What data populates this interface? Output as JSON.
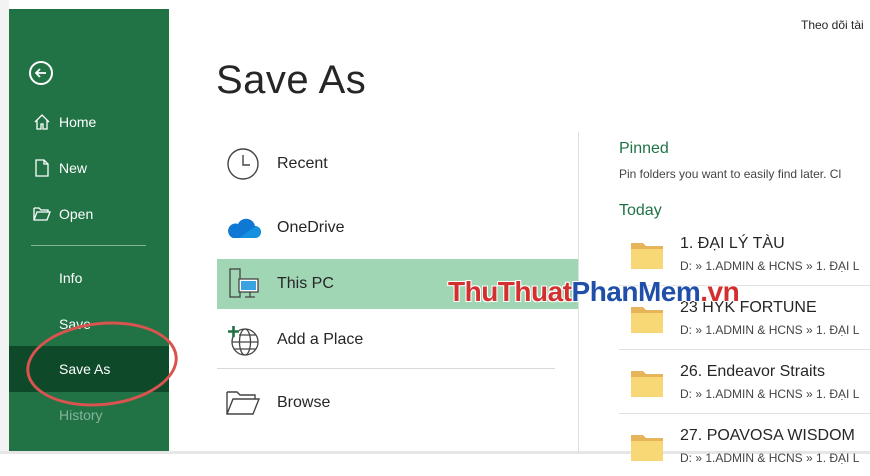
{
  "window": {
    "top_right_text": "Theo dõi tài"
  },
  "sidebar": {
    "items": [
      {
        "label": "Home",
        "icon": "home-icon"
      },
      {
        "label": "New",
        "icon": "new-document-icon"
      },
      {
        "label": "Open",
        "icon": "open-folder-icon"
      },
      {
        "label": "Info"
      },
      {
        "label": "Save"
      },
      {
        "label": "Save As",
        "selected": true
      },
      {
        "label": "History"
      }
    ],
    "accent_color": "#217346",
    "selected_color": "#0e4a2a"
  },
  "main": {
    "title": "Save As",
    "locations": [
      {
        "label": "Recent",
        "icon": "clock-icon"
      },
      {
        "label": "OneDrive",
        "icon": "onedrive-cloud-icon"
      },
      {
        "label": "This PC",
        "icon": "this-pc-icon",
        "selected": true
      },
      {
        "label": "Add a Place",
        "icon": "add-place-globe-icon"
      },
      {
        "label": "Browse",
        "icon": "browse-folder-icon"
      }
    ]
  },
  "right_panel": {
    "pinned_heading": "Pinned",
    "pinned_description": "Pin folders you want to easily find later. Cl",
    "today_heading": "Today",
    "folders": [
      {
        "name": "1. ĐẠI LÝ TÀU",
        "path": "D: » 1.ADMIN & HCNS » 1. ĐẠI L"
      },
      {
        "name": "23 HYK FORTUNE",
        "path": "D: » 1.ADMIN & HCNS » 1. ĐẠI L"
      },
      {
        "name": "26. Endeavor Straits",
        "path": "D: » 1.ADMIN & HCNS » 1. ĐẠI L"
      },
      {
        "name": "27. POAVOSA WISDOM",
        "path": "D: » 1.ADMIN & HCNS » 1. ĐẠI L"
      }
    ]
  },
  "watermark": {
    "part1": "ThuThuat",
    "part2": "PhanMem",
    "part3": ".vn"
  }
}
